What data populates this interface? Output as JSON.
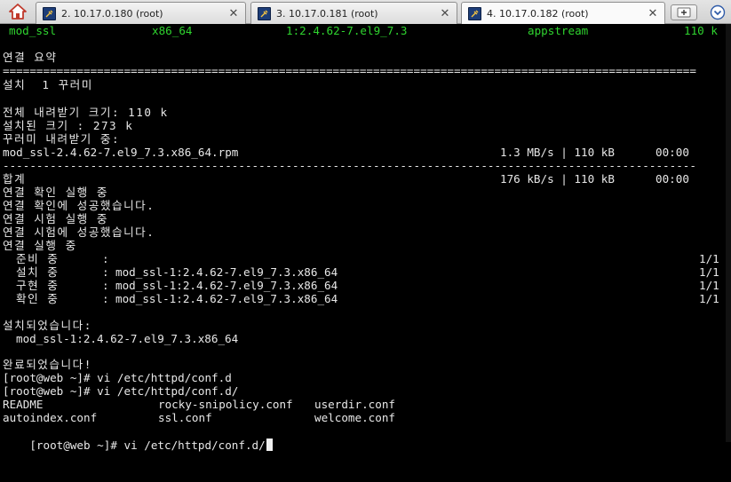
{
  "tabs": [
    {
      "label": "2. 10.17.0.180 (root)",
      "active": false
    },
    {
      "label": "3. 10.17.0.181 (root)",
      "active": false
    },
    {
      "label": "4. 10.17.0.182 (root)",
      "active": true
    }
  ],
  "package_row": {
    "name": "mod_ssl",
    "arch": "x86_64",
    "version": "1:2.4.62-7.el9_7.3",
    "repo": "appstream",
    "size": "110 k"
  },
  "summary_title": "연결 요약",
  "double_rule": "=======================================================================================================",
  "install_summary": "설치  1 꾸러미",
  "total_download": "전체 내려받기 크기: 110 k",
  "installed_size": "설치된 크기 : 273 k",
  "downloading": "꾸러미 내려받기 중:",
  "download_row": {
    "file": "mod_ssl-2.4.62-7.el9_7.3.x86_64.rpm",
    "speed": "1.3 MB/s | 110 kB",
    "time": "00:00"
  },
  "dash_rule": "-------------------------------------------------------------------------------------------------------",
  "total_row": {
    "label": "합계",
    "speed": "176 kB/s | 110 kB",
    "time": "00:00"
  },
  "transaction_lines": [
    "연결 확인 실행 중",
    "연결 확인에 성공했습니다.",
    "연결 시험 실행 중",
    "연결 시험에 성공했습니다.",
    "연결 실행 중"
  ],
  "steps": [
    {
      "label": "준비 중",
      "detail": "",
      "progress": "1/1"
    },
    {
      "label": "설치 중",
      "detail": "mod_ssl-1:2.4.62-7.el9_7.3.x86_64",
      "progress": "1/1"
    },
    {
      "label": "구현 중",
      "detail": "mod_ssl-1:2.4.62-7.el9_7.3.x86_64",
      "progress": "1/1"
    },
    {
      "label": "확인 중",
      "detail": "mod_ssl-1:2.4.62-7.el9_7.3.x86_64",
      "progress": "1/1"
    }
  ],
  "installed_header": "설치되었습니다:",
  "installed_pkg": "mod_ssl-1:2.4.62-7.el9_7.3.x86_64",
  "complete": "완료되었습니다!",
  "commands": [
    "[root@web ~]# vi /etc/httpd/conf.d",
    "[root@web ~]# vi /etc/httpd/conf.d/"
  ],
  "ls_rows": [
    [
      "README",
      "rocky-snipolicy.conf",
      "userdir.conf"
    ],
    [
      "autoindex.conf",
      "ssl.conf",
      "welcome.conf"
    ]
  ],
  "prompt": "[root@web ~]# vi /etc/httpd/conf.d/",
  "colors": {
    "terminal_bg": "#000000",
    "terminal_fg": "#e8e8e8",
    "highlight": "#2fd42f"
  },
  "icons": {
    "home": "home-icon",
    "tab": "session-icon",
    "close": "close-icon",
    "new_tab": "new-tab-icon",
    "menu": "menu-icon"
  }
}
